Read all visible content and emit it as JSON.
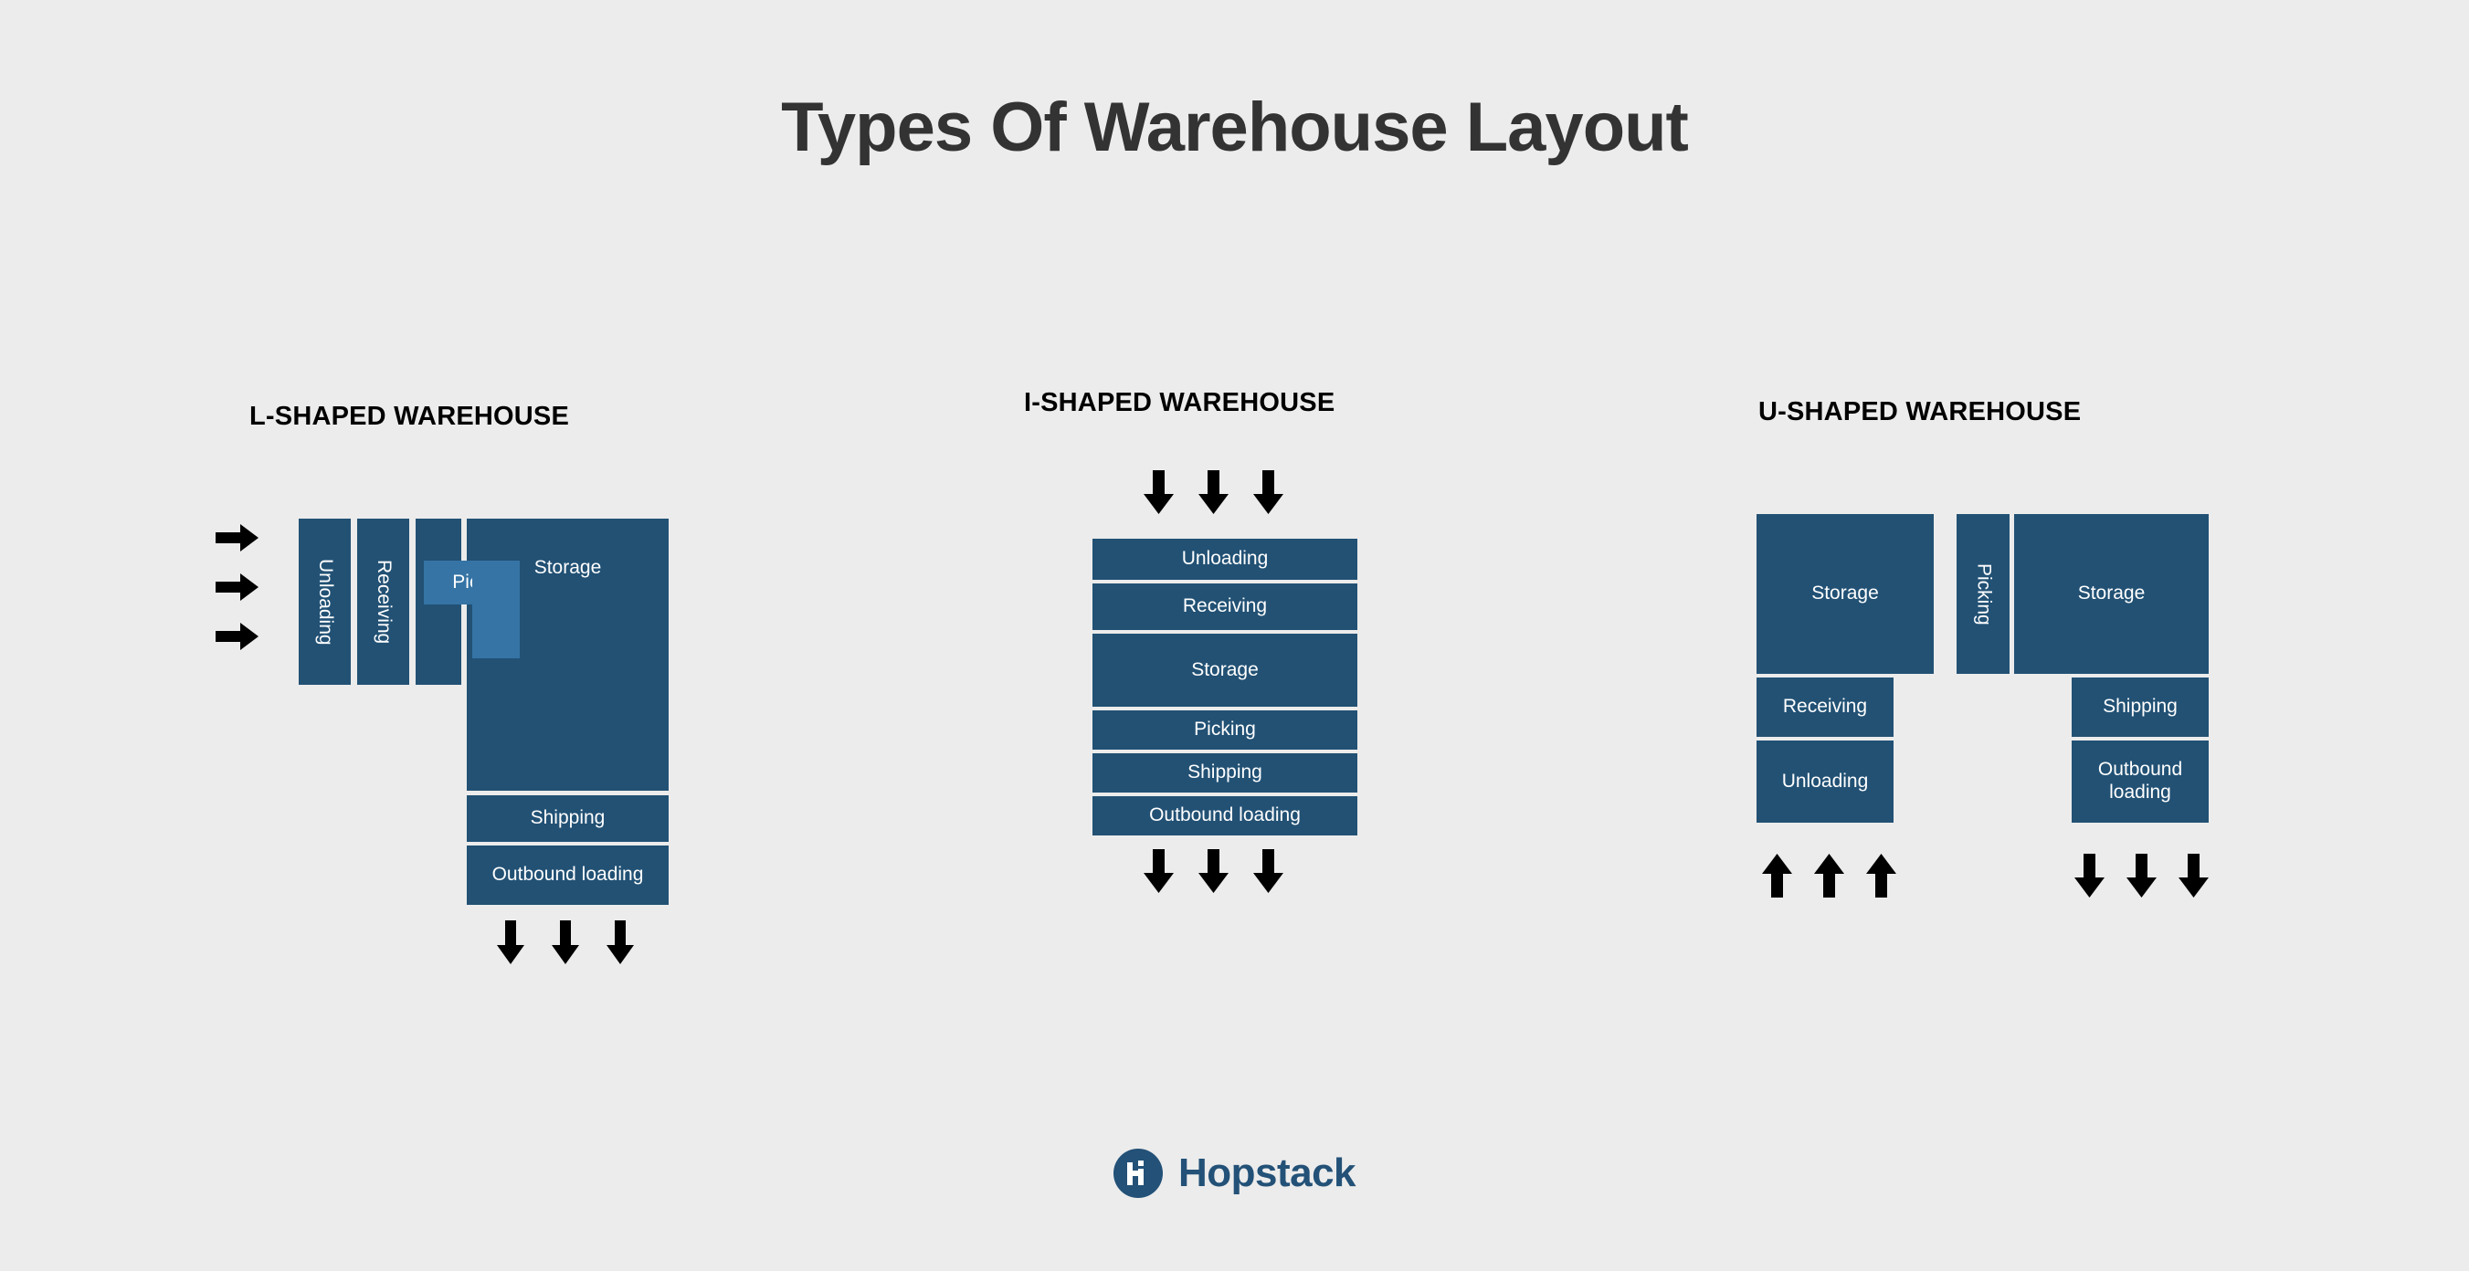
{
  "page": {
    "title": "Types Of Warehouse Layout",
    "background_color": "#ececec",
    "title_color": "#333333"
  },
  "colors": {
    "zone_dark_blue": "#225174",
    "zone_light_blue": "#3574a5",
    "zone_label": "#ffffff",
    "arrow": "#000000",
    "brand_blue": "#235177"
  },
  "layouts": [
    {
      "id": "l-shaped",
      "title": "L-SHAPED WAREHOUSE",
      "zones": [
        {
          "label": "Unloading",
          "orientation": "vertical",
          "shade": "dark"
        },
        {
          "label": "Receiving",
          "orientation": "vertical",
          "shade": "dark"
        },
        {
          "label": "Storage",
          "orientation": "horizontal",
          "shade": "dark"
        },
        {
          "label": "Picking",
          "orientation": "horizontal",
          "shade": "light"
        },
        {
          "label": "Shipping",
          "orientation": "horizontal",
          "shade": "dark"
        },
        {
          "label": "Outbound loading",
          "orientation": "horizontal",
          "shade": "dark"
        }
      ],
      "inbound_arrows": {
        "direction": "right",
        "count": 3
      },
      "outbound_arrows": {
        "direction": "down",
        "count": 3
      }
    },
    {
      "id": "i-shaped",
      "title": "I-SHAPED WAREHOUSE",
      "zones": [
        {
          "label": "Unloading",
          "orientation": "horizontal",
          "shade": "dark"
        },
        {
          "label": "Receiving",
          "orientation": "horizontal",
          "shade": "dark"
        },
        {
          "label": "Storage",
          "orientation": "horizontal",
          "shade": "dark"
        },
        {
          "label": "Picking",
          "orientation": "horizontal",
          "shade": "dark"
        },
        {
          "label": "Shipping",
          "orientation": "horizontal",
          "shade": "dark"
        },
        {
          "label": "Outbound loading",
          "orientation": "horizontal",
          "shade": "dark"
        }
      ],
      "inbound_arrows": {
        "direction": "down",
        "count": 3
      },
      "outbound_arrows": {
        "direction": "down",
        "count": 3
      }
    },
    {
      "id": "u-shaped",
      "title": "U-SHAPED WAREHOUSE",
      "zones": [
        {
          "label": "Storage",
          "orientation": "horizontal",
          "shade": "dark"
        },
        {
          "label": "Picking",
          "orientation": "vertical",
          "shade": "dark"
        },
        {
          "label": "Storage",
          "orientation": "horizontal",
          "shade": "dark"
        },
        {
          "label": "Receiving",
          "orientation": "horizontal",
          "shade": "dark"
        },
        {
          "label": "Unloading",
          "orientation": "horizontal",
          "shade": "dark"
        },
        {
          "label": "Shipping",
          "orientation": "horizontal",
          "shade": "dark"
        },
        {
          "label": "Outbound loading",
          "orientation": "horizontal",
          "shade": "dark"
        }
      ],
      "inbound_arrows": {
        "direction": "up",
        "count": 3
      },
      "outbound_arrows": {
        "direction": "down",
        "count": 3
      }
    }
  ],
  "footer": {
    "brand_name": "Hopstack",
    "logo_glyph": "Hi"
  }
}
